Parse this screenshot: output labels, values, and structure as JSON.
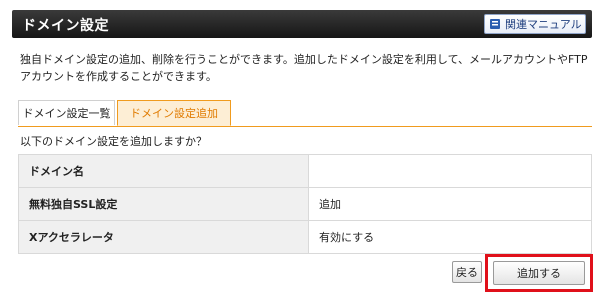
{
  "header": {
    "title": "ドメイン設定",
    "manual_label": "関連マニュアル",
    "manual_icon": "book-icon"
  },
  "description": "独自ドメイン設定の追加、削除を行うことができます。追加したドメイン設定を利用して、メールアカウントやFTPアカウントを作成することができます。",
  "tabs": [
    {
      "label": "ドメイン設定一覧",
      "active": false
    },
    {
      "label": "ドメイン設定追加",
      "active": true
    }
  ],
  "confirm_question": "以下のドメイン設定を追加しますか？",
  "form_rows": [
    {
      "label": "ドメイン名",
      "value": ""
    },
    {
      "label": "無料独自SSL設定",
      "value": "追加"
    },
    {
      "label": "Xアクセラレータ",
      "value": "有効にする"
    }
  ],
  "buttons": {
    "back": "戻る",
    "submit": "追加する"
  },
  "colors": {
    "titlebar": "#1e1e1e",
    "active_tab_text": "#e07b00",
    "active_tab_bg": "#fdeed5",
    "highlight_border": "#e0101a"
  }
}
